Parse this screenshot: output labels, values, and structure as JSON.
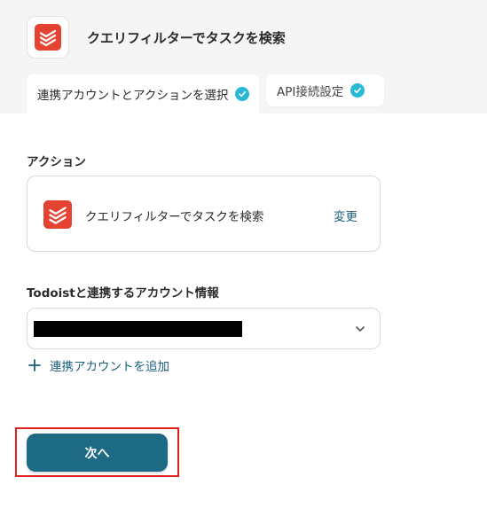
{
  "header": {
    "title": "クエリフィルターでタスクを検索",
    "app_icon": "todoist-icon"
  },
  "tabs": [
    {
      "label": "連携アカウントとアクションを選択",
      "completed": true,
      "active": true
    },
    {
      "label": "API接続設定",
      "completed": true,
      "active": false
    }
  ],
  "action_section": {
    "label": "アクション",
    "action_name": "クエリフィルターでタスクを検索",
    "change_label": "変更"
  },
  "account_section": {
    "label": "Todoistと連携するアカウント情報",
    "selected_value_redacted": true,
    "add_account_label": "連携アカウントを追加"
  },
  "footer": {
    "next_label": "次へ"
  },
  "colors": {
    "accent": "#1d6a85",
    "link": "#1b5f7c",
    "check": "#28b8d8",
    "todoist_red": "#e44332",
    "highlight": "#e0201f"
  }
}
